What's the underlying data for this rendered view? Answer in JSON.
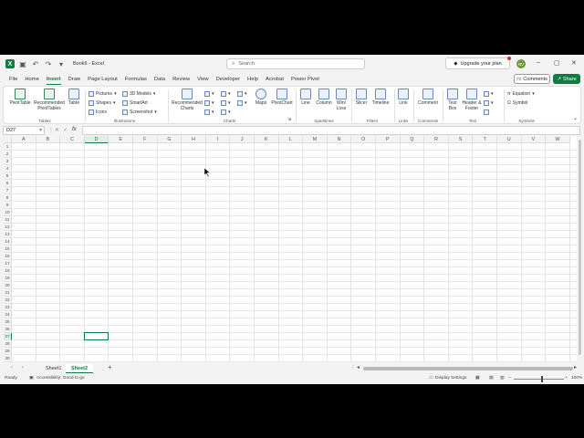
{
  "title": "Book6 - Excel",
  "search_placeholder": "Search",
  "upgrade_label": "Upgrade your plan",
  "user_initials": "NV",
  "menu": [
    "File",
    "Home",
    "Insert",
    "Draw",
    "Page Layout",
    "Formulas",
    "Data",
    "Review",
    "View",
    "Developer",
    "Help",
    "Acrobat",
    "Power Pivot"
  ],
  "menu_active": "Insert",
  "comments_label": "Comments",
  "share_label": "Share",
  "ribbon": {
    "pivottable": "PivotTable",
    "recommended_pivot": "Recommended PivotTables",
    "table": "Table",
    "pictures": "Pictures",
    "shapes": "Shapes",
    "icons": "Icons",
    "models3d": "3D Models",
    "smartart": "SmartArt",
    "screenshot": "Screenshot",
    "recommended_charts": "Recommended Charts",
    "maps": "Maps",
    "pivotchart": "PivotChart",
    "line": "Line",
    "column": "Column",
    "winloss": "Win/ Loss",
    "slicer": "Slicer",
    "timeline": "Timeline",
    "link": "Link",
    "comment": "Comment",
    "textbox": "Text Box",
    "header_footer": "Header & Footer",
    "equation": "Equation",
    "symbol": "Symbol",
    "groups": {
      "tables": "Tables",
      "illustrations": "Illustrations",
      "charts": "Charts",
      "sparklines": "Sparklines",
      "filters": "Filters",
      "links": "Links",
      "comments": "Comments",
      "text": "Text",
      "symbols": "Symbols"
    }
  },
  "namebox": "D27",
  "columns": [
    "A",
    "B",
    "C",
    "D",
    "E",
    "F",
    "G",
    "H",
    "I",
    "J",
    "K",
    "L",
    "M",
    "N",
    "O",
    "P",
    "Q",
    "R",
    "S",
    "T",
    "U",
    "V",
    "W"
  ],
  "selected_column": "D",
  "rows": [
    "1",
    "2",
    "3",
    "4",
    "5",
    "6",
    "7",
    "8",
    "9",
    "10",
    "11",
    "12",
    "13",
    "14",
    "15",
    "16",
    "17",
    "18",
    "19",
    "20",
    "21",
    "22",
    "23",
    "24",
    "25",
    "26",
    "27",
    "28",
    "29",
    "30"
  ],
  "selected_row": "27",
  "sheets": [
    "Sheet1",
    "Sheet2"
  ],
  "active_sheet": "Sheet2",
  "status": {
    "ready": "Ready",
    "accessibility": "Accessibility: Good to go",
    "display_settings": "Display Settings",
    "zoom": "100%"
  },
  "colors": {
    "accent": "#107c41"
  }
}
